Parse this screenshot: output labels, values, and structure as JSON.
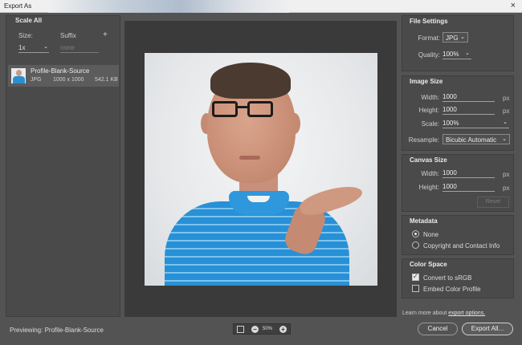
{
  "window": {
    "title": "Export As",
    "close_glyph": "×"
  },
  "left_panel": {
    "header": "Scale All",
    "size_label": "Size:",
    "suffix_label": "Suffix",
    "add_glyph": "+",
    "size_value": "1x",
    "suffix_placeholder": "none",
    "asset": {
      "name": "Profile-Blank-Source",
      "format": "JPG",
      "dimensions": "1000 x 1000",
      "filesize": "542.1 KB"
    }
  },
  "footer": {
    "previewing": "Previewing: Profile-Blank-Source",
    "zoom": "50%",
    "zoom_out_glyph": "−",
    "zoom_in_glyph": "+",
    "learn_more_prefix": "Learn more about",
    "learn_more_link": "export options.",
    "cancel_label": "Cancel",
    "export_label": "Export All..."
  },
  "file_settings": {
    "title": "File Settings",
    "format_label": "Format:",
    "format_value": "JPG",
    "quality_label": "Quality:",
    "quality_value": "100%"
  },
  "image_size": {
    "title": "Image Size",
    "width_label": "Width:",
    "width_value": "1000",
    "height_label": "Height:",
    "height_value": "1000",
    "unit": "px",
    "scale_label": "Scale:",
    "scale_value": "100%",
    "resample_label": "Resample:",
    "resample_value": "Bicubic Automatic"
  },
  "canvas_size": {
    "title": "Canvas Size",
    "width_label": "Width:",
    "width_value": "1000",
    "height_label": "Height:",
    "height_value": "1000",
    "unit": "px",
    "reset_label": "Reset"
  },
  "metadata": {
    "title": "Metadata",
    "option_none": "None",
    "option_copyright": "Copyright and Contact Info",
    "selected": "None"
  },
  "color_space": {
    "title": "Color Space",
    "convert_label": "Convert to sRGB",
    "convert_checked": true,
    "embed_label": "Embed Color Profile",
    "embed_checked": false
  }
}
